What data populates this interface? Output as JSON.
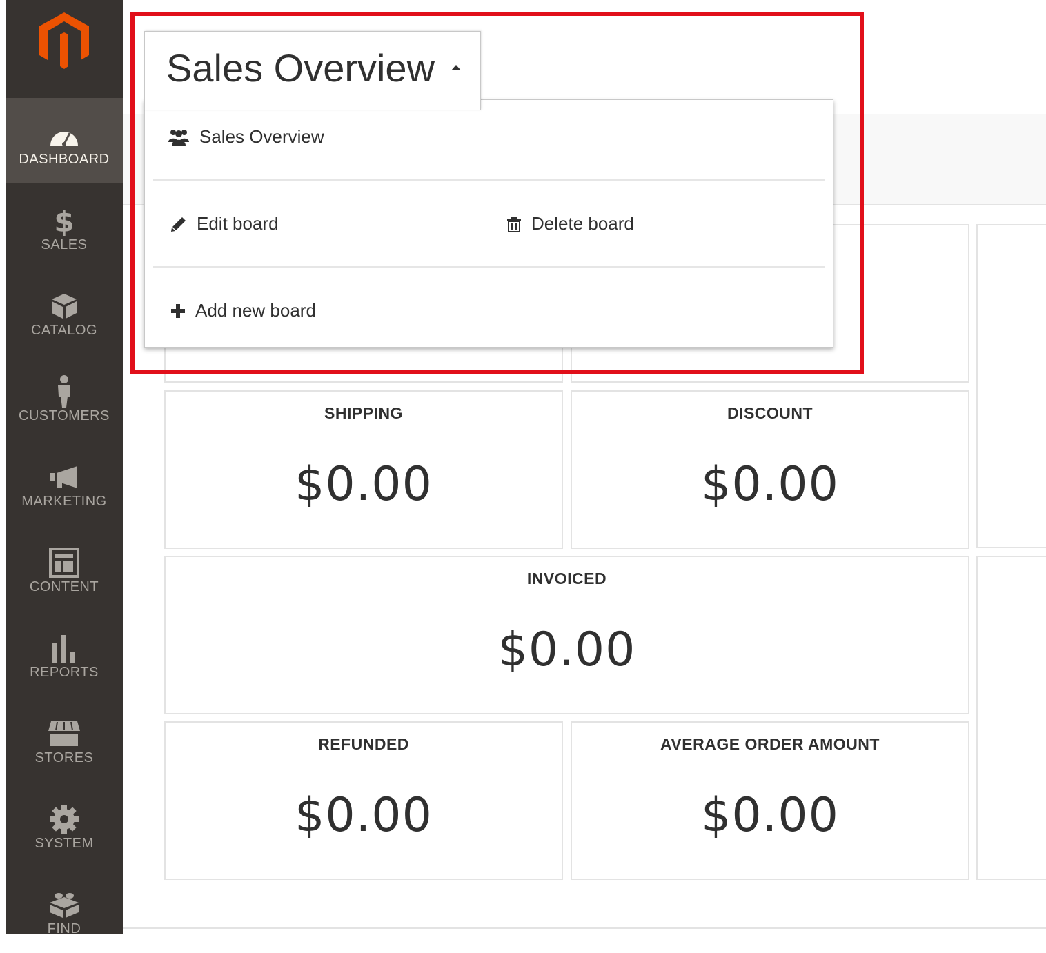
{
  "sidebar": {
    "items": [
      {
        "label": "DASHBOARD",
        "icon": "dashboard-icon"
      },
      {
        "label": "SALES",
        "icon": "dollar-icon"
      },
      {
        "label": "CATALOG",
        "icon": "box-icon"
      },
      {
        "label": "CUSTOMERS",
        "icon": "person-icon"
      },
      {
        "label": "MARKETING",
        "icon": "megaphone-icon"
      },
      {
        "label": "CONTENT",
        "icon": "layout-icon"
      },
      {
        "label": "REPORTS",
        "icon": "bar-chart-icon"
      },
      {
        "label": "STORES",
        "icon": "storefront-icon"
      },
      {
        "label": "SYSTEM",
        "icon": "gear-icon"
      },
      {
        "label": "FIND",
        "icon": "lego-block-icon"
      }
    ],
    "active": "DASHBOARD",
    "accent": "#eb5202"
  },
  "board_selector": {
    "title": "Sales Overview",
    "menu": {
      "board": "Sales Overview",
      "edit": "Edit board",
      "delete": "Delete board",
      "add": "Add new board"
    }
  },
  "tiles": {
    "shipping": {
      "title": "SHIPPING",
      "value": "$0.00"
    },
    "discount": {
      "title": "DISCOUNT",
      "value": "$0.00"
    },
    "invoiced": {
      "title": "INVOICED",
      "value": "$0.00"
    },
    "refunded": {
      "title": "REFUNDED",
      "value": "$0.00"
    },
    "average_order": {
      "title": "AVERAGE ORDER AMOUNT",
      "value": "$0.00"
    }
  },
  "highlight_color": "#e10f1a"
}
